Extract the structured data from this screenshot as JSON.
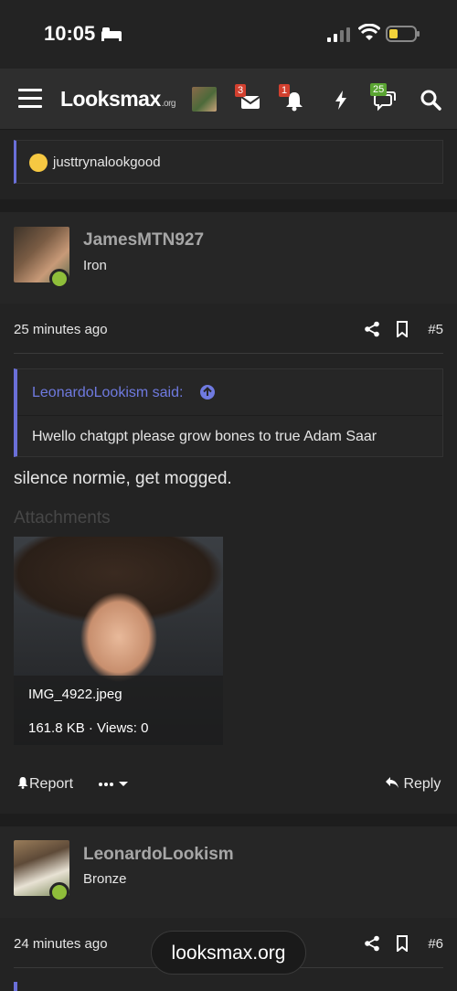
{
  "status": {
    "time": "10:05"
  },
  "nav": {
    "logo_main": "Looksmax",
    "logo_suffix": ".org",
    "badges": {
      "conversations": "3",
      "alerts": "1",
      "chat": "25"
    }
  },
  "quote_top": {
    "user": "justtrynalookgood"
  },
  "posts": [
    {
      "username": "JamesMTN927",
      "rank": "Iron",
      "time": "25 minutes ago",
      "number": "#5",
      "quote_author": "LeonardoLookism said:",
      "quote_text": "Hwello chatgpt please grow bones to true Adam Saar",
      "body": "silence normie, get mogged.",
      "attachments_heading": "Attachments",
      "attachment": {
        "filename": "IMG_4922.jpeg",
        "meta": "161.8 KB · Views: 0"
      },
      "actions": {
        "report": "Report",
        "reply": "Reply"
      }
    },
    {
      "username": "LeonardoLookism",
      "rank": "Bronze",
      "time": "24 minutes ago",
      "number": "#6"
    }
  ],
  "toast": "looksmax.org",
  "colors": {
    "accent": "#6a6fd8",
    "online": "#8fbe3a",
    "badge_red": "#d2402f",
    "badge_green": "#5aa532"
  }
}
